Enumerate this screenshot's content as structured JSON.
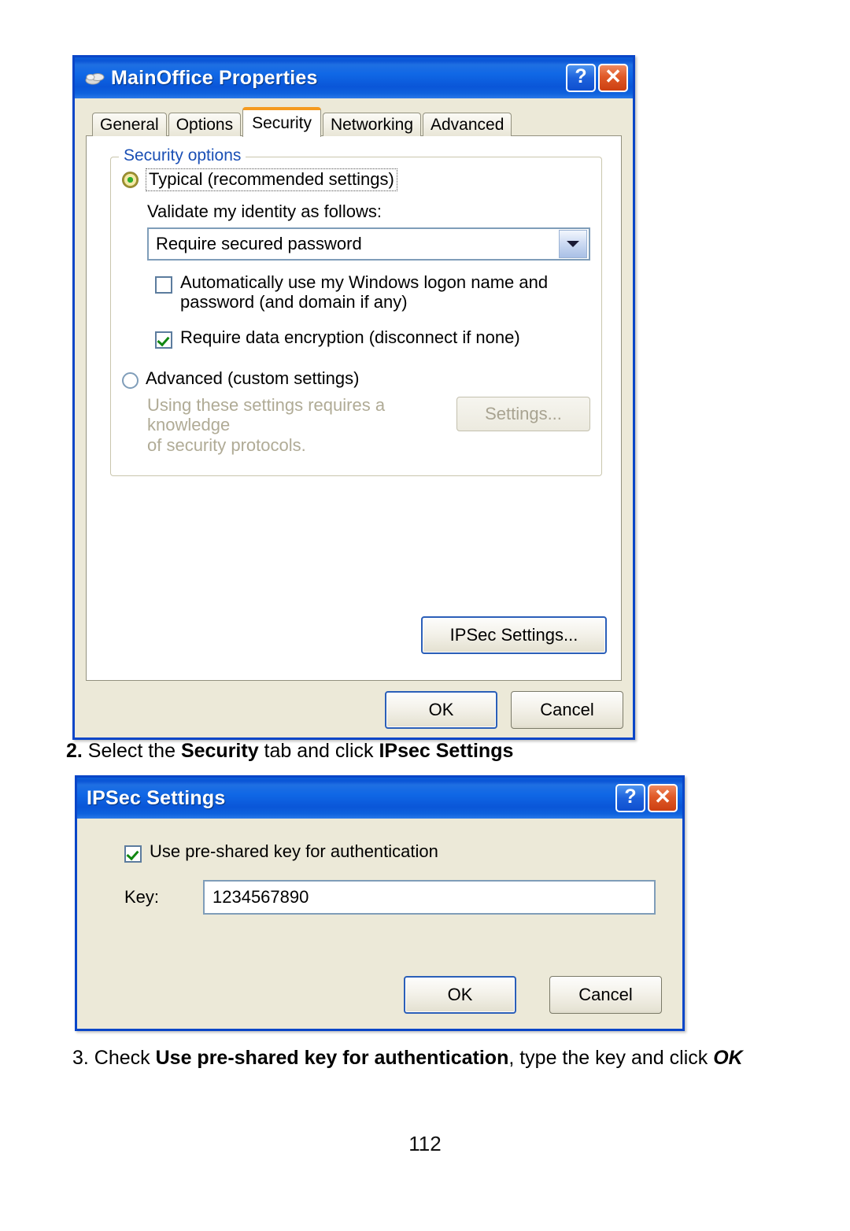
{
  "dialog_properties": {
    "title": "MainOffice Properties",
    "title_icon": "network-connection-icon",
    "help_button": "?",
    "close_button": "✕",
    "tabs": [
      {
        "label": "General",
        "active": false
      },
      {
        "label": "Options",
        "active": false
      },
      {
        "label": "Security",
        "active": true
      },
      {
        "label": "Networking",
        "active": false
      },
      {
        "label": "Advanced",
        "active": false
      }
    ],
    "groupbox": {
      "title": "Security options",
      "typical_radio": {
        "label": "Typical (recommended settings)",
        "selected": true,
        "focused": true
      },
      "validate_label": "Validate my identity as follows:",
      "validate_combo": {
        "value": "Require secured password",
        "arrow_icon": "chevron-down-icon"
      },
      "auto_logon_checkbox": {
        "label_line1": "Automatically use my Windows logon name and",
        "label_line2": "password (and domain if any)",
        "checked": false
      },
      "encryption_checkbox": {
        "label": "Require data encryption (disconnect if none)",
        "checked": true
      },
      "advanced_radio": {
        "label": "Advanced (custom settings)",
        "selected": false
      },
      "advanced_desc_line1": "Using these settings requires a knowledge",
      "advanced_desc_line2": "of security protocols.",
      "settings_button": "Settings...",
      "settings_button_disabled": true
    },
    "ipsec_settings_button": "IPSec Settings...",
    "ok_button": "OK",
    "cancel_button": "Cancel"
  },
  "dialog_ipsec": {
    "title": "IPSec Settings",
    "help_button": "?",
    "close_button": "✕",
    "preshared_checkbox": {
      "label": "Use pre-shared key for authentication",
      "checked": true
    },
    "key_label": "Key:",
    "key_value": "1234567890",
    "ok_button": "OK",
    "cancel_button": "Cancel"
  },
  "captions": {
    "step2": {
      "number": "2.",
      "part1": " Select the ",
      "bold1": "Security",
      "part2": " tab and click ",
      "bold2": "IPsec Settings"
    },
    "step3": {
      "part1": "3. Check ",
      "bold1": "Use pre-shared key for authentication",
      "part2": ", type the key and click ",
      "italic_bold": "OK"
    }
  },
  "page_number": "112",
  "colors": {
    "titlebar_blue": "#0a56d8",
    "dialog_face": "#ece9d8",
    "active_tab_accent": "#f59a1e",
    "groupbox_label": "#1a4fb5",
    "check_green": "#118811",
    "close_red": "#cc3f12"
  }
}
